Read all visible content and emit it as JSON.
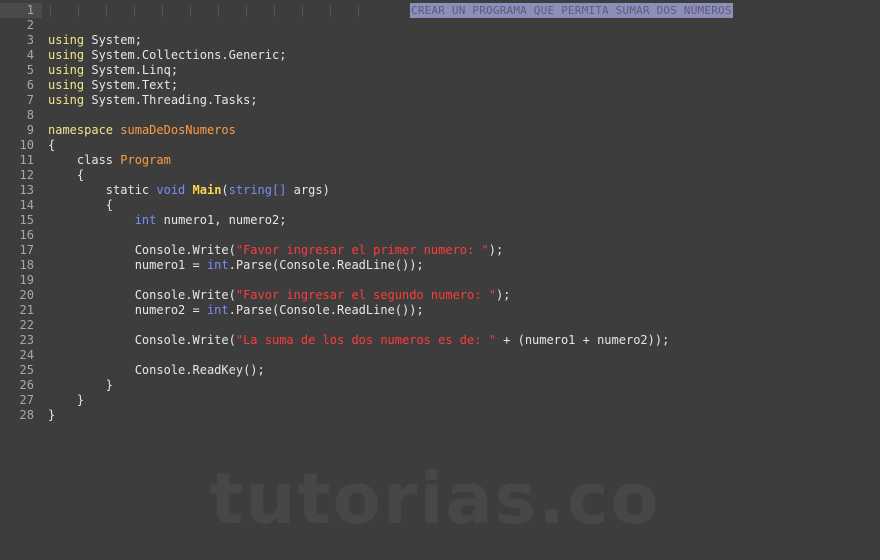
{
  "editor": {
    "header_comment": "CREAR UN PROGRAMA QUE PERMITA SUMAR DOS NÚMEROS",
    "watermark": "tutorias.co",
    "line_numbers": [
      "1",
      "2",
      "3",
      "4",
      "5",
      "6",
      "7",
      "8",
      "9",
      "10",
      "11",
      "12",
      "13",
      "14",
      "15",
      "16",
      "17",
      "18",
      "19",
      "20",
      "21",
      "22",
      "23",
      "24",
      "25",
      "26",
      "27",
      "28"
    ],
    "lines": [
      [],
      [],
      [
        {
          "t": "using",
          "c": "kw"
        },
        {
          "t": " System;",
          "c": ""
        }
      ],
      [
        {
          "t": "using",
          "c": "kw"
        },
        {
          "t": " System.Collections.Generic;",
          "c": ""
        }
      ],
      [
        {
          "t": "using",
          "c": "kw"
        },
        {
          "t": " System.Linq;",
          "c": ""
        }
      ],
      [
        {
          "t": "using",
          "c": "kw"
        },
        {
          "t": " System.Text;",
          "c": ""
        }
      ],
      [
        {
          "t": "using",
          "c": "kw"
        },
        {
          "t": " System.Threading.Tasks;",
          "c": ""
        }
      ],
      [],
      [
        {
          "t": "namespace",
          "c": "kw"
        },
        {
          "t": " ",
          "c": ""
        },
        {
          "t": "sumaDeDosNumeros",
          "c": "ty"
        }
      ],
      [
        {
          "t": "{",
          "c": ""
        }
      ],
      [
        {
          "t": "    class ",
          "c": ""
        },
        {
          "t": "Program",
          "c": "ty"
        }
      ],
      [
        {
          "t": "    {",
          "c": ""
        }
      ],
      [
        {
          "t": "        static ",
          "c": ""
        },
        {
          "t": "void",
          "c": "kw2"
        },
        {
          "t": " ",
          "c": ""
        },
        {
          "t": "Main",
          "c": "fn"
        },
        {
          "t": "(",
          "c": ""
        },
        {
          "t": "string[]",
          "c": "kw2"
        },
        {
          "t": " args)",
          "c": ""
        }
      ],
      [
        {
          "t": "        {",
          "c": ""
        }
      ],
      [
        {
          "t": "            ",
          "c": ""
        },
        {
          "t": "int",
          "c": "kw2"
        },
        {
          "t": " numero1, numero2;",
          "c": ""
        }
      ],
      [],
      [
        {
          "t": "            Console.Write(",
          "c": ""
        },
        {
          "t": "\"Favor ingresar el primer numero: \"",
          "c": "str"
        },
        {
          "t": ");",
          "c": ""
        }
      ],
      [
        {
          "t": "            numero1 = ",
          "c": ""
        },
        {
          "t": "int",
          "c": "kw2"
        },
        {
          "t": ".Parse(Console.ReadLine());",
          "c": ""
        }
      ],
      [],
      [
        {
          "t": "            Console.Write(",
          "c": ""
        },
        {
          "t": "\"Favor ingresar el segundo numero: \"",
          "c": "str"
        },
        {
          "t": ");",
          "c": ""
        }
      ],
      [
        {
          "t": "            numero2 = ",
          "c": ""
        },
        {
          "t": "int",
          "c": "kw2"
        },
        {
          "t": ".Parse(Console.ReadLine());",
          "c": ""
        }
      ],
      [],
      [
        {
          "t": "            Console.Write(",
          "c": ""
        },
        {
          "t": "\"La suma de los dos numeros es de: \"",
          "c": "str"
        },
        {
          "t": " + (numero1 + numero2));",
          "c": ""
        }
      ],
      [],
      [
        {
          "t": "            Console.ReadKey();",
          "c": ""
        }
      ],
      [
        {
          "t": "        }",
          "c": ""
        }
      ],
      [
        {
          "t": "    }",
          "c": ""
        }
      ],
      [
        {
          "t": "}",
          "c": ""
        }
      ]
    ]
  }
}
